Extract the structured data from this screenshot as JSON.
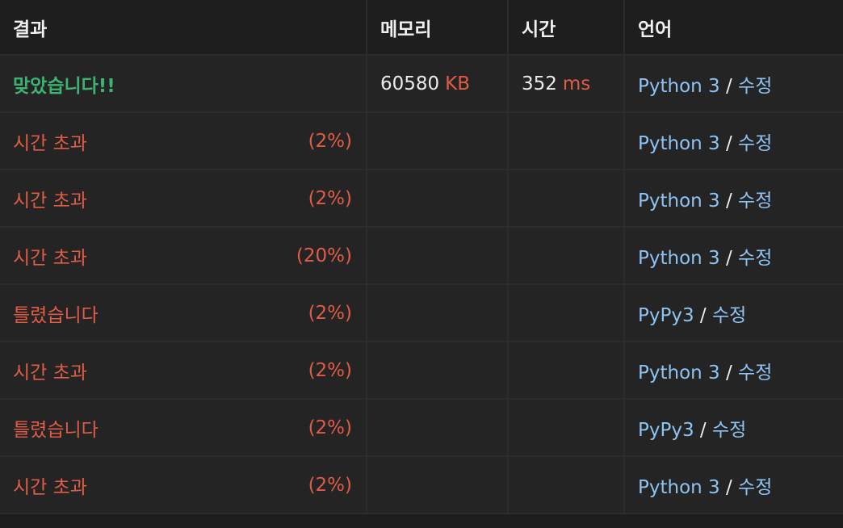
{
  "headers": [
    "결과",
    "메모리",
    "시간",
    "언어"
  ],
  "rows": [
    {
      "status": "맞았습니다!!",
      "status_type": "accepted",
      "percent": "",
      "memory": "60580",
      "memory_unit": "KB",
      "time": "352",
      "time_unit": "ms",
      "language": "Python 3",
      "separator": "/",
      "edit": "수정"
    },
    {
      "status": "시간 초과",
      "status_type": "fail",
      "percent": "(2%)",
      "memory": "",
      "memory_unit": "",
      "time": "",
      "time_unit": "",
      "language": "Python 3",
      "separator": "/",
      "edit": "수정"
    },
    {
      "status": "시간 초과",
      "status_type": "fail",
      "percent": "(2%)",
      "memory": "",
      "memory_unit": "",
      "time": "",
      "time_unit": "",
      "language": "Python 3",
      "separator": "/",
      "edit": "수정"
    },
    {
      "status": "시간 초과",
      "status_type": "fail",
      "percent": "(20%)",
      "memory": "",
      "memory_unit": "",
      "time": "",
      "time_unit": "",
      "language": "Python 3",
      "separator": "/",
      "edit": "수정"
    },
    {
      "status": "틀렸습니다",
      "status_type": "fail",
      "percent": "(2%)",
      "memory": "",
      "memory_unit": "",
      "time": "",
      "time_unit": "",
      "language": "PyPy3",
      "separator": "/",
      "edit": "수정"
    },
    {
      "status": "시간 초과",
      "status_type": "fail",
      "percent": "(2%)",
      "memory": "",
      "memory_unit": "",
      "time": "",
      "time_unit": "",
      "language": "Python 3",
      "separator": "/",
      "edit": "수정"
    },
    {
      "status": "틀렸습니다",
      "status_type": "fail",
      "percent": "(2%)",
      "memory": "",
      "memory_unit": "",
      "time": "",
      "time_unit": "",
      "language": "PyPy3",
      "separator": "/",
      "edit": "수정"
    },
    {
      "status": "시간 초과",
      "status_type": "fail",
      "percent": "(2%)",
      "memory": "",
      "memory_unit": "",
      "time": "",
      "time_unit": "",
      "language": "Python 3",
      "separator": "/",
      "edit": "수정"
    }
  ],
  "colors": {
    "accepted": "#3cb371",
    "fail": "#e15c46",
    "link": "#8ec3f2",
    "background": "#1e1e1e",
    "row_background": "#242424"
  }
}
